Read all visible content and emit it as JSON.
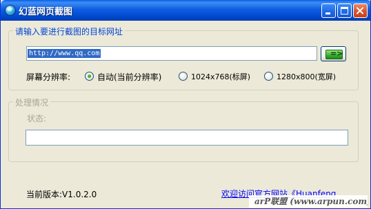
{
  "window": {
    "title": "幻蓝网页截图",
    "icon": "globe-app-icon",
    "controls": [
      "minimize-icon",
      "maximize-icon",
      "close-icon"
    ]
  },
  "url_group": {
    "legend": "请输入要进行截图的目标网址",
    "url_value": "http://www.qq.com",
    "go_label": "=>"
  },
  "resolution": {
    "label": "屏幕分辨率:",
    "options": [
      "自动(当前分辨率)",
      "1024x768(标屏)",
      "1280x800(宽屏)"
    ],
    "selected": "自动(当前分辨率)"
  },
  "process_group": {
    "legend": "处理情况",
    "status_label": "状态:",
    "status_value": ""
  },
  "footer": {
    "version": "当前版本:V1.0.2.0",
    "website_link": "欢迎访问官方网站《Huanfeng",
    "watermark": "arP联盟 (www.arpun.com)"
  },
  "colors": {
    "titlebar": "#0a5fe6",
    "window_bg": "#ece9d8",
    "legend_blue": "#0046d5",
    "legend_disabled": "#a9a892",
    "link": "#0000ff"
  }
}
